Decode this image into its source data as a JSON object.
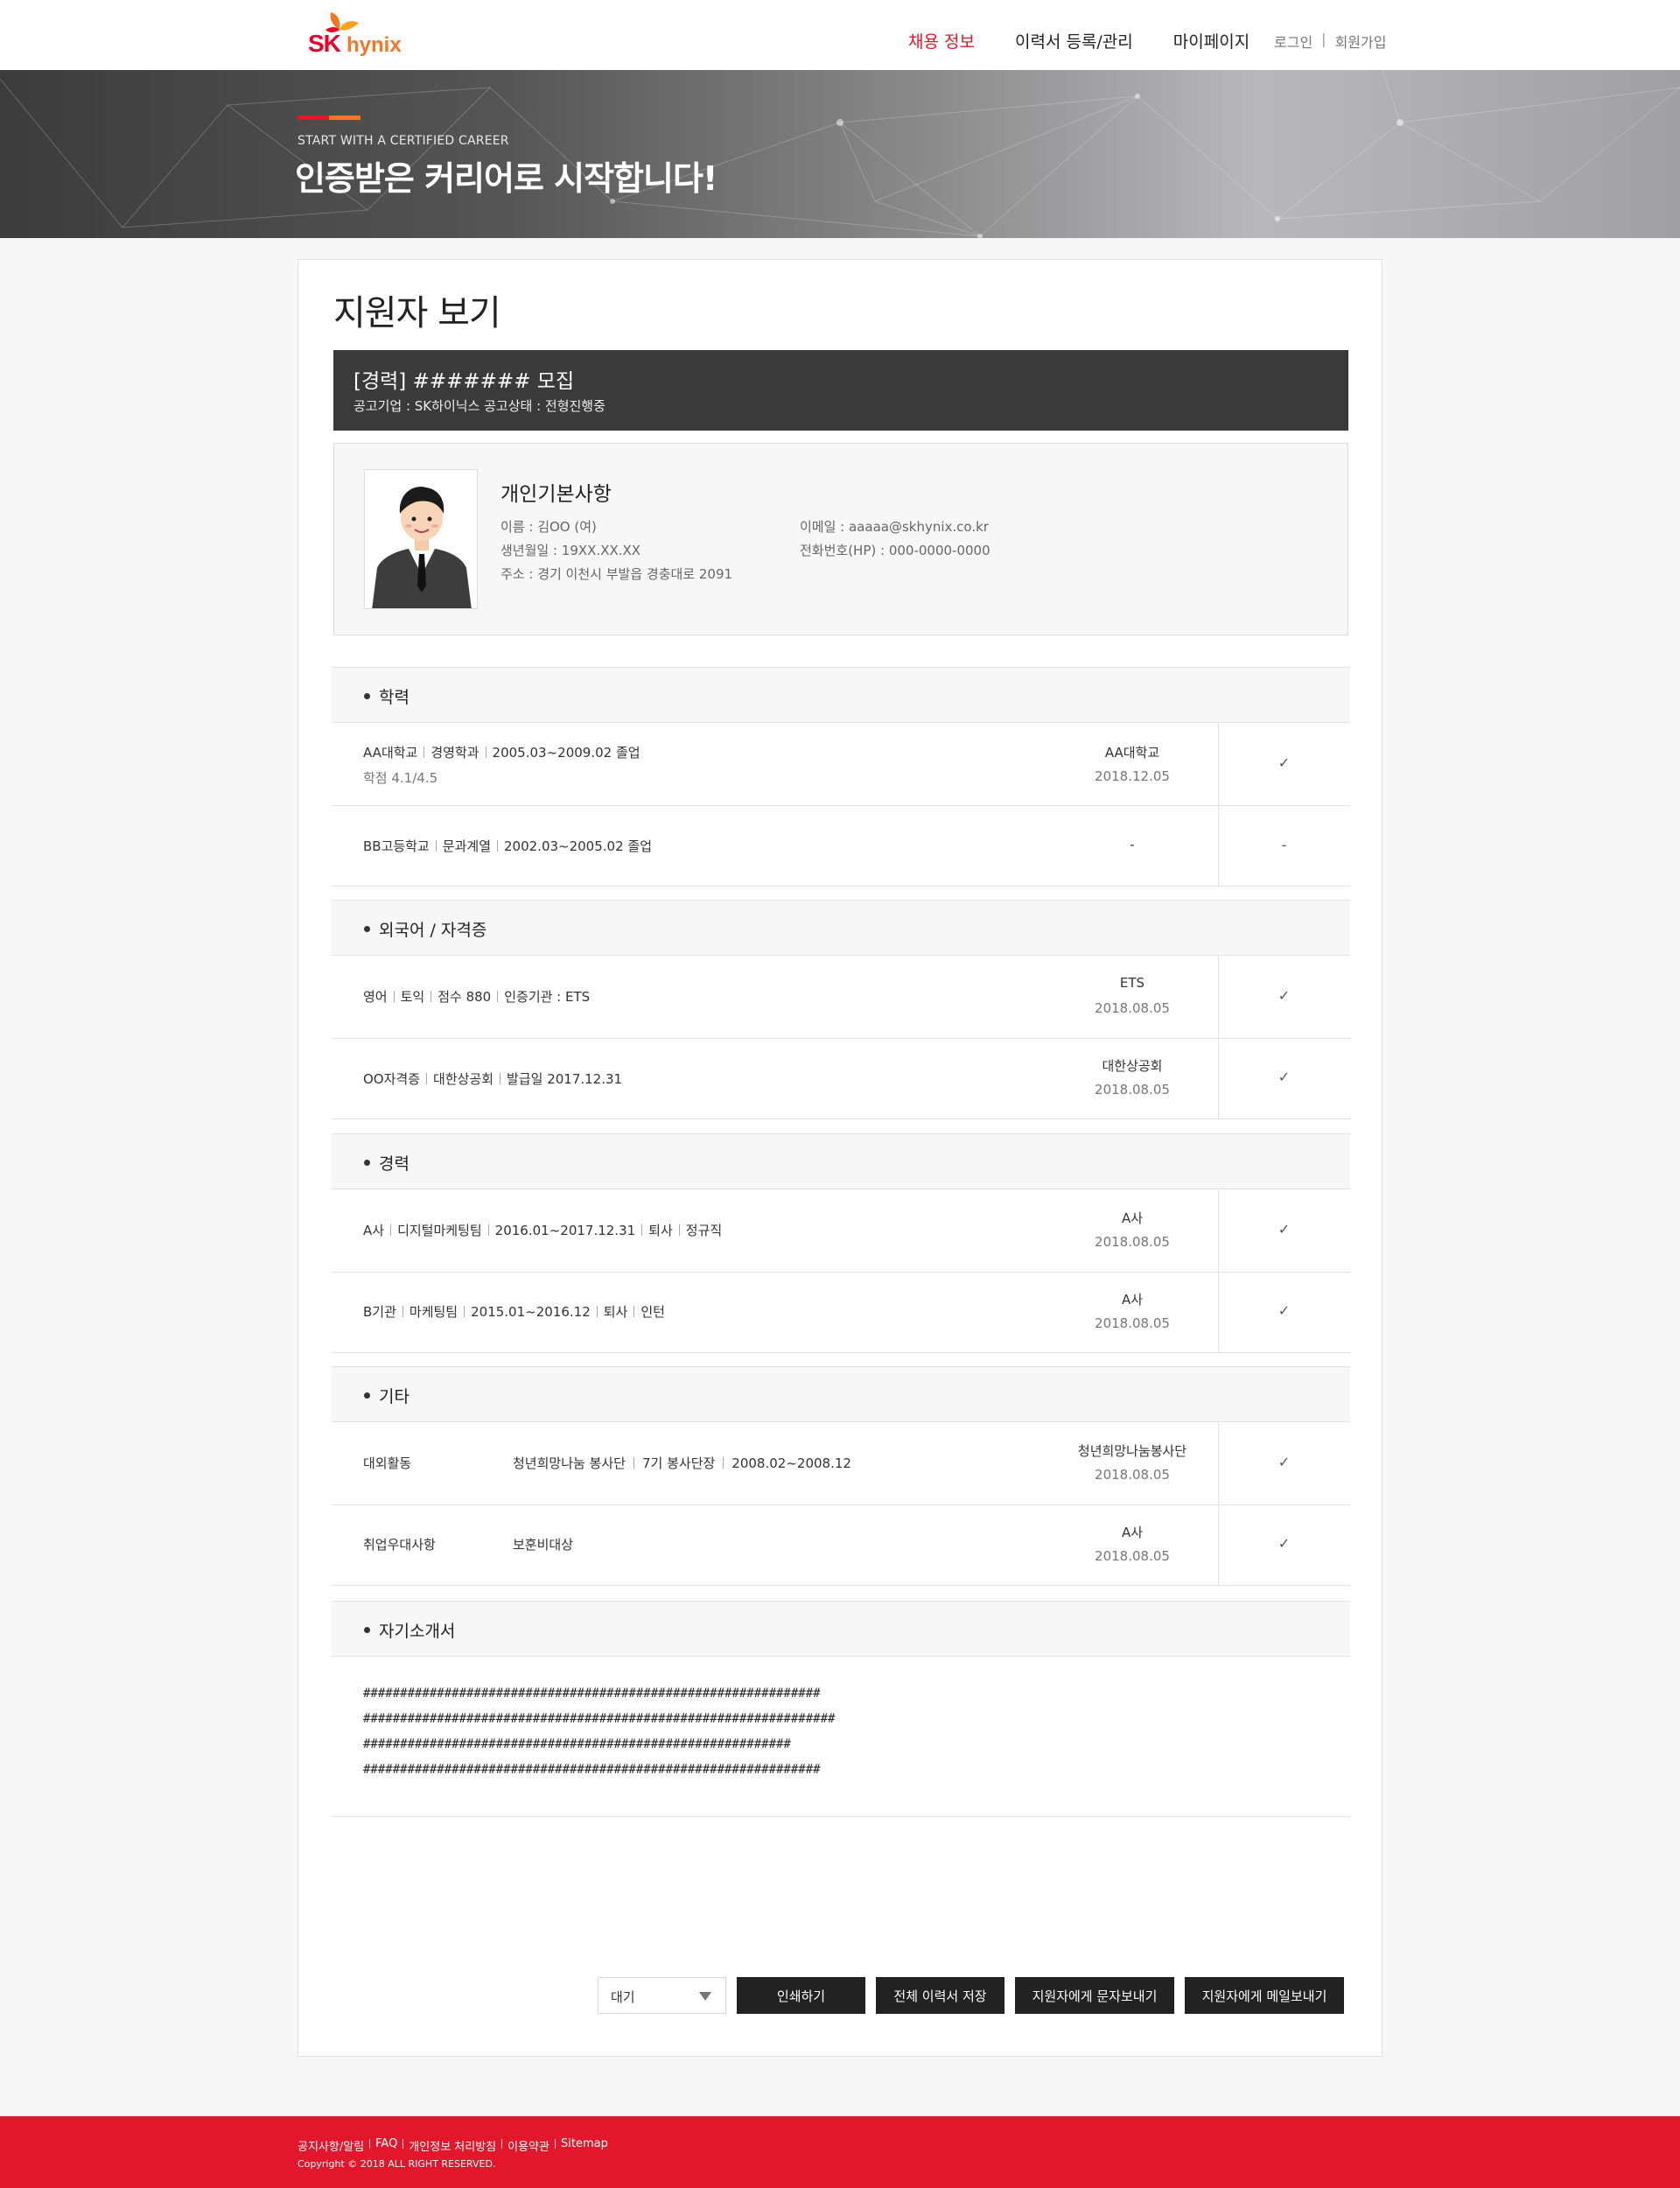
{
  "header": {
    "logo_sk": "SK",
    "logo_hynix": "hynix",
    "nav": [
      "채용 정보",
      "이력서 등록/관리",
      "마이페이지"
    ],
    "login": "로그인",
    "signup": "회원가입",
    "accent_color": "#e2172c"
  },
  "banner": {
    "subtitle": "START WITH A CERTIFIED CAREER",
    "title": "인증받은 커리어로 시작합니다!",
    "bar_colors": [
      "#e2172c",
      "#f47725"
    ]
  },
  "page": {
    "title": "지원자 보기",
    "posting_title": "[경력] ####### 모집",
    "posting_info": "공고기업 : SK하이닉스  공고상태 : 전형진행중"
  },
  "profile": {
    "heading": "개인기본사항",
    "name": "이름  : 김OO (여)",
    "birth": "생년월일 : 19XX.XX.XX",
    "address": "주소 : 경기 이천시 부발읍 경충대로 2091",
    "email": "이메일 : aaaaa@skhynix.co.kr",
    "phone": "전화번호(HP) : 000-0000-0000"
  },
  "education": {
    "heading": "학력",
    "rows": [
      {
        "parts": [
          "AA대학교",
          "경영학과",
          "2005.03~2009.02 졸업"
        ],
        "sub": "학점 4.1/4.5",
        "org": "AA대학교",
        "date": "2018.12.05",
        "mark": "✓"
      },
      {
        "parts": [
          "BB고등학교",
          "문과계열",
          "2002.03~2005.02 졸업"
        ],
        "org": "-",
        "mark": "-"
      }
    ]
  },
  "languages": {
    "heading": "외국어 / 자격증",
    "rows": [
      {
        "parts": [
          "영어",
          "토익",
          "점수 880",
          "인증기관 : ETS"
        ],
        "org": "ETS",
        "date": "2018.08.05",
        "mark": "✓"
      },
      {
        "parts": [
          "OO자격증",
          "대한상공회",
          "발급일 2017.12.31"
        ],
        "org": "대한상공회",
        "date": "2018.08.05",
        "mark": "✓"
      }
    ]
  },
  "career": {
    "heading": "경력",
    "rows": [
      {
        "parts": [
          "A사",
          "디지털마케팅팀",
          "2016.01~2017.12.31",
          "퇴사",
          "정규직"
        ],
        "org": "A사",
        "date": "2018.08.05",
        "mark": "✓"
      },
      {
        "parts": [
          "B기관",
          "마케팅팀",
          "2015.01~2016.12",
          "퇴사",
          "인턴"
        ],
        "org": "A사",
        "date": "2018.08.05",
        "mark": "✓"
      }
    ]
  },
  "etc": {
    "heading": "기타",
    "rows": [
      {
        "key": "대외활동",
        "parts": [
          "청년희망나눔 봉사단",
          "7기 봉사단장",
          "2008.02~2008.12"
        ],
        "org": "청년희망나눔봉사단",
        "date": "2018.08.05",
        "mark": "✓"
      },
      {
        "key": "취업우대사항",
        "parts": [
          "보훈비대상"
        ],
        "org": "A사",
        "date": "2018.08.05",
        "mark": "✓"
      }
    ]
  },
  "intro": {
    "heading": "자기소개서",
    "lines": [
      "##############################################################",
      "################################################################",
      "##########################################################",
      "##############################################################"
    ]
  },
  "actions": {
    "status_select": "대기",
    "print": "인쇄하기",
    "save_all": "전체 이력서 저장",
    "send_sms": "지원자에게 문자보내기",
    "send_mail": "지원자에게 메일보내기"
  },
  "footer": {
    "links": [
      "공지사항/알림",
      "FAQ",
      "개인정보 처리방침",
      "이용약관",
      "Sitemap"
    ],
    "copyright": "Copyright © 2018  ALL RIGHT RESERVED."
  }
}
